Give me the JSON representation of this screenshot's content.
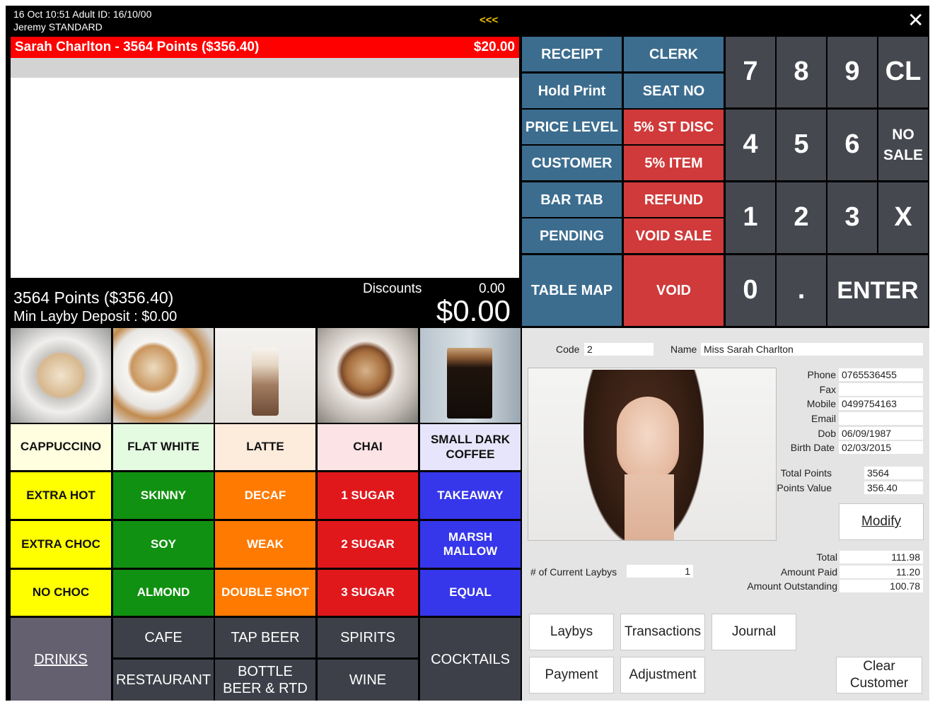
{
  "header": {
    "datetime_line": "16 Oct 10:51   Adult ID: 16/10/00",
    "clerk_line": "Jeremy  STANDARD",
    "arrows": "<<<",
    "close_glyph": "✕"
  },
  "customer_bar": {
    "name": "Sarah Charlton  -  3564 Points ($356.40)",
    "amount": "$20.00"
  },
  "totals": {
    "points_line": "3564 Points ($356.40)",
    "layby_line": "Min Layby Deposit : $0.00",
    "discounts_label": "Discounts",
    "discounts_value": "0.00",
    "total": "$0.00"
  },
  "function_keys": {
    "receipt": "RECEIPT",
    "clerk": "CLERK",
    "hold_print": "Hold Print",
    "seat_no": "SEAT NO",
    "price_level": "PRICE LEVEL",
    "st_disc": "5% ST DISC",
    "customer": "CUSTOMER",
    "item_disc": "5% ITEM",
    "bar_tab": "BAR TAB",
    "refund": "REFUND",
    "pending": "PENDING",
    "void_sale": "VOID SALE",
    "table_map": "TABLE MAP",
    "void": "VOID"
  },
  "keypad": {
    "k7": "7",
    "k8": "8",
    "k9": "9",
    "cl": "CL",
    "k4": "4",
    "k5": "5",
    "k6": "6",
    "no_sale_1": "NO",
    "no_sale_2": "SALE",
    "k1": "1",
    "k2": "2",
    "k3": "3",
    "x": "X",
    "k0": "0",
    "dot": ".",
    "enter": "ENTER"
  },
  "products": {
    "row1": [
      "CAPPUCCINO",
      "FLAT WHITE",
      "LATTE",
      "CHAI",
      "SMALL DARK COFFEE"
    ],
    "row2": [
      "EXTRA HOT",
      "SKINNY",
      "DECAF",
      "1 SUGAR",
      "TAKEAWAY"
    ],
    "row3": [
      "EXTRA CHOC",
      "SOY",
      "WEAK",
      "2 SUGAR",
      "MARSH MALLOW"
    ],
    "row4": [
      "NO CHOC",
      "ALMOND",
      "DOUBLE SHOT",
      "3 SUGAR",
      "EQUAL"
    ]
  },
  "categories": {
    "drinks": "DRINKS",
    "cafe": "CAFE",
    "tap_beer": "TAP BEER",
    "spirits": "SPIRITS",
    "cocktails": "COCKTAILS",
    "restaurant": "RESTAURANT",
    "bottle_beer": "BOTTLE BEER & RTD",
    "wine": "WINE"
  },
  "customer_panel": {
    "code_label": "Code",
    "code_value": "2",
    "name_label": "Name",
    "name_value": "Miss Sarah  Charlton",
    "phone_label": "Phone",
    "phone_value": "0765536455",
    "fax_label": "Fax",
    "fax_value": "",
    "mobile_label": "Mobile",
    "mobile_value": "0499754163",
    "email_label": "Email",
    "email_value": "",
    "dob_label": "Dob",
    "dob_value": "06/09/1987",
    "birth_label": "Birth Date",
    "birth_value": "02/03/2015",
    "total_points_label": "Total Points",
    "total_points_value": "3564",
    "points_value_label": "Points Value",
    "points_value_value": "356.40",
    "modify": "Modify",
    "laybys_label": "# of Current Laybys",
    "laybys_value": "1",
    "total_label": "Total",
    "total_value": "111.98",
    "paid_label": "Amount Paid",
    "paid_value": "11.20",
    "outstanding_label": "Amount Outstanding",
    "outstanding_value": "100.78",
    "btn_laybys": "Laybys",
    "btn_transactions": "Transactions",
    "btn_journal": "Journal",
    "btn_payment": "Payment",
    "btn_adjustment": "Adjustment",
    "btn_clear": "Clear Customer"
  },
  "colors": {
    "fn_blue": "#3c6d8f",
    "fn_red": "#d03a3a",
    "keypad": "#464850",
    "customer_bar": "#ff0000"
  }
}
